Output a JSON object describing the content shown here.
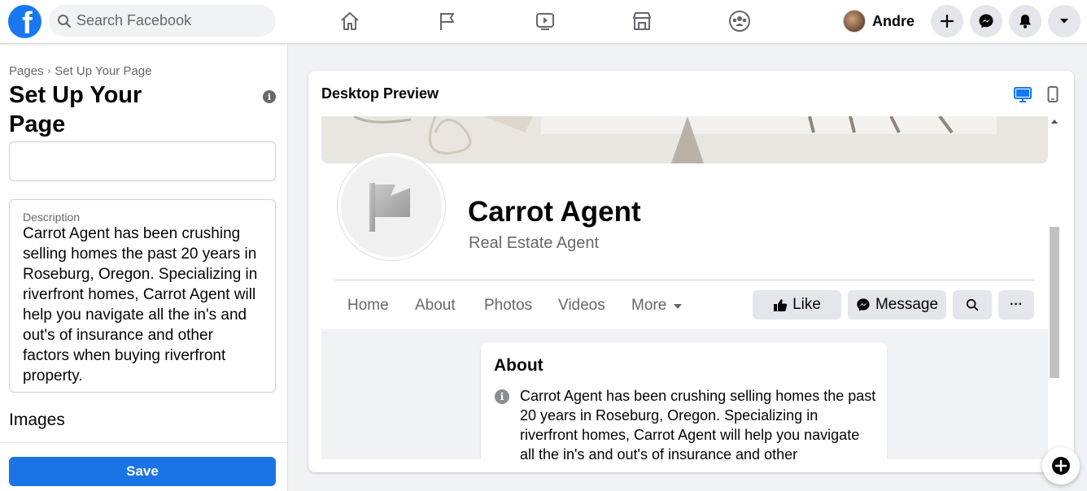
{
  "topbar": {
    "logo_letter": "f",
    "search_placeholder": "Search Facebook",
    "user_name": "Andre",
    "nav_icons": [
      "home-icon",
      "flag-icon",
      "watch-icon",
      "marketplace-icon",
      "groups-icon"
    ],
    "action_icons": [
      "plus-icon",
      "messenger-icon",
      "bell-icon",
      "chevron-down-icon"
    ],
    "accent": "#1877f2"
  },
  "left_panel": {
    "breadcrumb": [
      "Pages",
      "Set Up Your Page"
    ],
    "breadcrumb_separator": "›",
    "title": "Set Up Your Page",
    "info_glyph": "i",
    "description_label": "Description",
    "description_text": "Carrot Agent has been crushing selling homes the past 20 years in Roseburg, Oregon. Specializing in riverfront homes, Carrot Agent will help you navigate all the in's and out's of insurance and other factors when buying riverfront property.",
    "images_label": "Images",
    "save_label": "Save",
    "save_color": "#1b74e4"
  },
  "preview": {
    "title": "Desktop Preview",
    "device_icons": [
      "desktop-icon",
      "mobile-icon"
    ],
    "page_name": "Carrot Agent",
    "page_category": "Real Estate Agent",
    "tabs": [
      "Home",
      "About",
      "Photos",
      "Videos",
      "More"
    ],
    "buttons": {
      "like": "Like",
      "message": "Message",
      "more": "···"
    },
    "about": {
      "title": "About",
      "text": "Carrot Agent has been crushing selling homes the past 20 years in Roseburg, Oregon. Specializing in riverfront homes, Carrot Agent will help you navigate all the in's and out's of insurance and other"
    }
  }
}
